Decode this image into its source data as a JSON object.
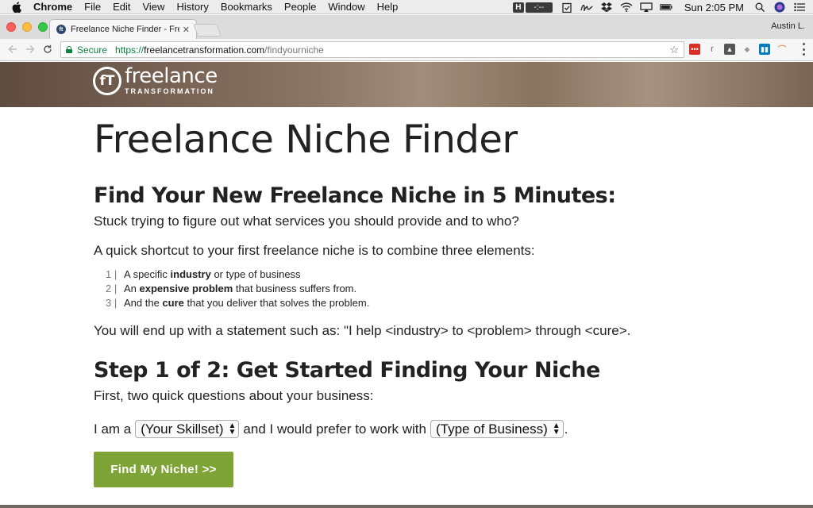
{
  "menubar": {
    "app": "Chrome",
    "items": [
      "File",
      "Edit",
      "View",
      "History",
      "Bookmarks",
      "People",
      "Window",
      "Help"
    ],
    "badge_h": "H",
    "badge_dots": "-:--",
    "clock": "Sun 2:05 PM"
  },
  "browser": {
    "tab_title": "Freelance Niche Finder - Freel",
    "profile": "Austin L.",
    "secure_label": "Secure",
    "url_scheme": "https://",
    "url_host": "freelancetransformation.com",
    "url_path": "/findyourniche"
  },
  "logo": {
    "mark": "fT",
    "name": "freelance",
    "tagline": "TRANSFORMATION"
  },
  "main": {
    "title": "Freelance Niche Finder",
    "subtitle": "Find Your New Freelance Niche in 5 Minutes:",
    "intro": "Stuck trying to figure out what services you should provide and to who?",
    "shortcut": "A quick shortcut to your first freelance niche is to combine three elements:",
    "list": [
      {
        "num": "1 |",
        "before": "A specific ",
        "bold": "industry",
        "after": " or type of business"
      },
      {
        "num": "2 |",
        "before": "An ",
        "bold": "expensive problem",
        "after": " that business suffers from."
      },
      {
        "num": "3 |",
        "before": "And the ",
        "bold": "cure",
        "after": " that you deliver that solves the problem."
      }
    ],
    "statement": "You will end up with a statement such as: \"I help <industry> to <problem> through <cure>.",
    "step_heading": "Step 1 of 2: Get Started Finding Your Niche",
    "step_intro": "First, two quick questions about your business:",
    "form": {
      "lead": "I am a",
      "skillset_value": "(Your Skillset)",
      "middle": "and I would prefer to work with",
      "business_value": "(Type of Business)",
      "end": "."
    },
    "button": "Find My Niche! >>"
  }
}
